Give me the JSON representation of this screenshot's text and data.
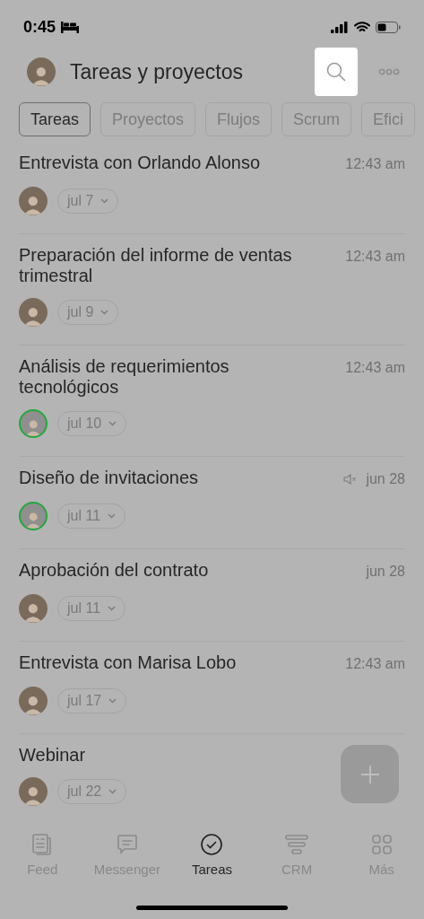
{
  "status_bar": {
    "time": "0:45"
  },
  "header": {
    "title": "Tareas y proyectos"
  },
  "tabs": [
    {
      "label": "Tareas",
      "selected": true
    },
    {
      "label": "Proyectos",
      "selected": false
    },
    {
      "label": "Flujos",
      "selected": false
    },
    {
      "label": "Scrum",
      "selected": false
    },
    {
      "label": "Efici",
      "selected": false
    }
  ],
  "tasks": [
    {
      "title": "Entrevista con Orlando Alonso",
      "time": "12:43 am",
      "muted": false,
      "date": "jul 7",
      "avatar_ring": false
    },
    {
      "title": "Preparación del informe de ventas trimestral",
      "time": "12:43 am",
      "muted": false,
      "date": "jul 9",
      "avatar_ring": false
    },
    {
      "title": "Análisis de requerimientos tecnológicos",
      "time": "12:43 am",
      "muted": false,
      "date": "jul 10",
      "avatar_ring": true
    },
    {
      "title": "Diseño de invitaciones",
      "time": "jun 28",
      "muted": true,
      "date": "jul 11",
      "avatar_ring": true
    },
    {
      "title": "Aprobación del contrato",
      "time": "jun 28",
      "muted": false,
      "date": "jul 11",
      "avatar_ring": false
    },
    {
      "title": "Entrevista con Marisa Lobo",
      "time": "12:43 am",
      "muted": false,
      "date": "jul 17",
      "avatar_ring": false
    },
    {
      "title": "Webinar",
      "muted": false,
      "date": "jul 22",
      "avatar_ring": false
    }
  ],
  "bottom_nav": [
    {
      "label": "Feed",
      "kind": "feed",
      "selected": false
    },
    {
      "label": "Messenger",
      "kind": "chat",
      "selected": false
    },
    {
      "label": "Tareas",
      "kind": "tasks",
      "selected": true
    },
    {
      "label": "CRM",
      "kind": "crm",
      "selected": false
    },
    {
      "label": "Más",
      "kind": "more",
      "selected": false
    }
  ]
}
